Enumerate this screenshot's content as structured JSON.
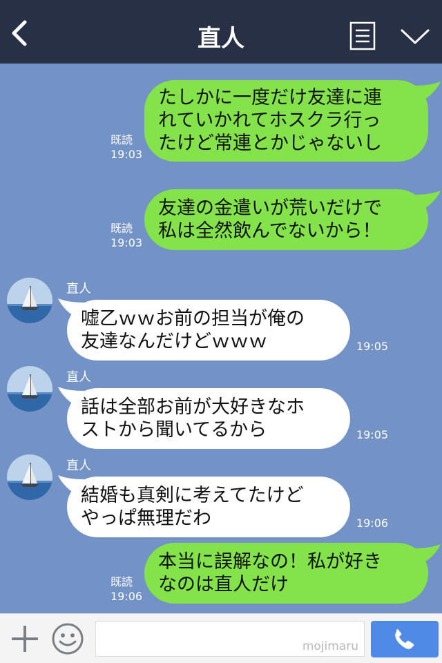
{
  "header": {
    "title": "直人",
    "back_icon": "chevron-left-icon",
    "menu_icon": "notes-icon",
    "collapse_icon": "chevron-down-icon"
  },
  "messages": [
    {
      "direction": "out",
      "lines": [
        "たしかに一度だけ友達に連",
        "れていかれてホスクラ行っ",
        "たけど常連とかじゃないし"
      ],
      "read": "既読",
      "time": "19:03"
    },
    {
      "direction": "out",
      "lines": [
        "友達の金遣いが荒いだけで",
        "私は全然飲んでないから！"
      ],
      "read": "既読",
      "time": "19:03"
    },
    {
      "direction": "in",
      "sender": "直人",
      "lines": [
        "嘘乙ｗｗお前の担当が俺の",
        "友達なんだけどｗｗｗ"
      ],
      "time": "19:05"
    },
    {
      "direction": "in",
      "sender": "直人",
      "lines": [
        "話は全部お前が大好きなホ",
        "ストから聞いてるから"
      ],
      "time": "19:05"
    },
    {
      "direction": "in",
      "sender": "直人",
      "lines": [
        "結婚も真剣に考えてたけど",
        "やっぱ無理だわ"
      ],
      "time": "19:06"
    },
    {
      "direction": "out",
      "lines": [
        "本当に誤解なの！私が好き",
        "なのは直人だけ"
      ],
      "read": "既読",
      "time": "19:06"
    }
  ],
  "input_bar": {
    "plus_icon": "plus-icon",
    "emoji_icon": "smiley-icon",
    "watermark": "mojimaru",
    "call_icon": "phone-icon"
  },
  "colors": {
    "header_bg": "#283046",
    "chat_bg": "#7392c5",
    "outgoing_bubble": "#84e34b",
    "incoming_bubble": "#ffffff",
    "call_button": "#4f8ae6"
  }
}
